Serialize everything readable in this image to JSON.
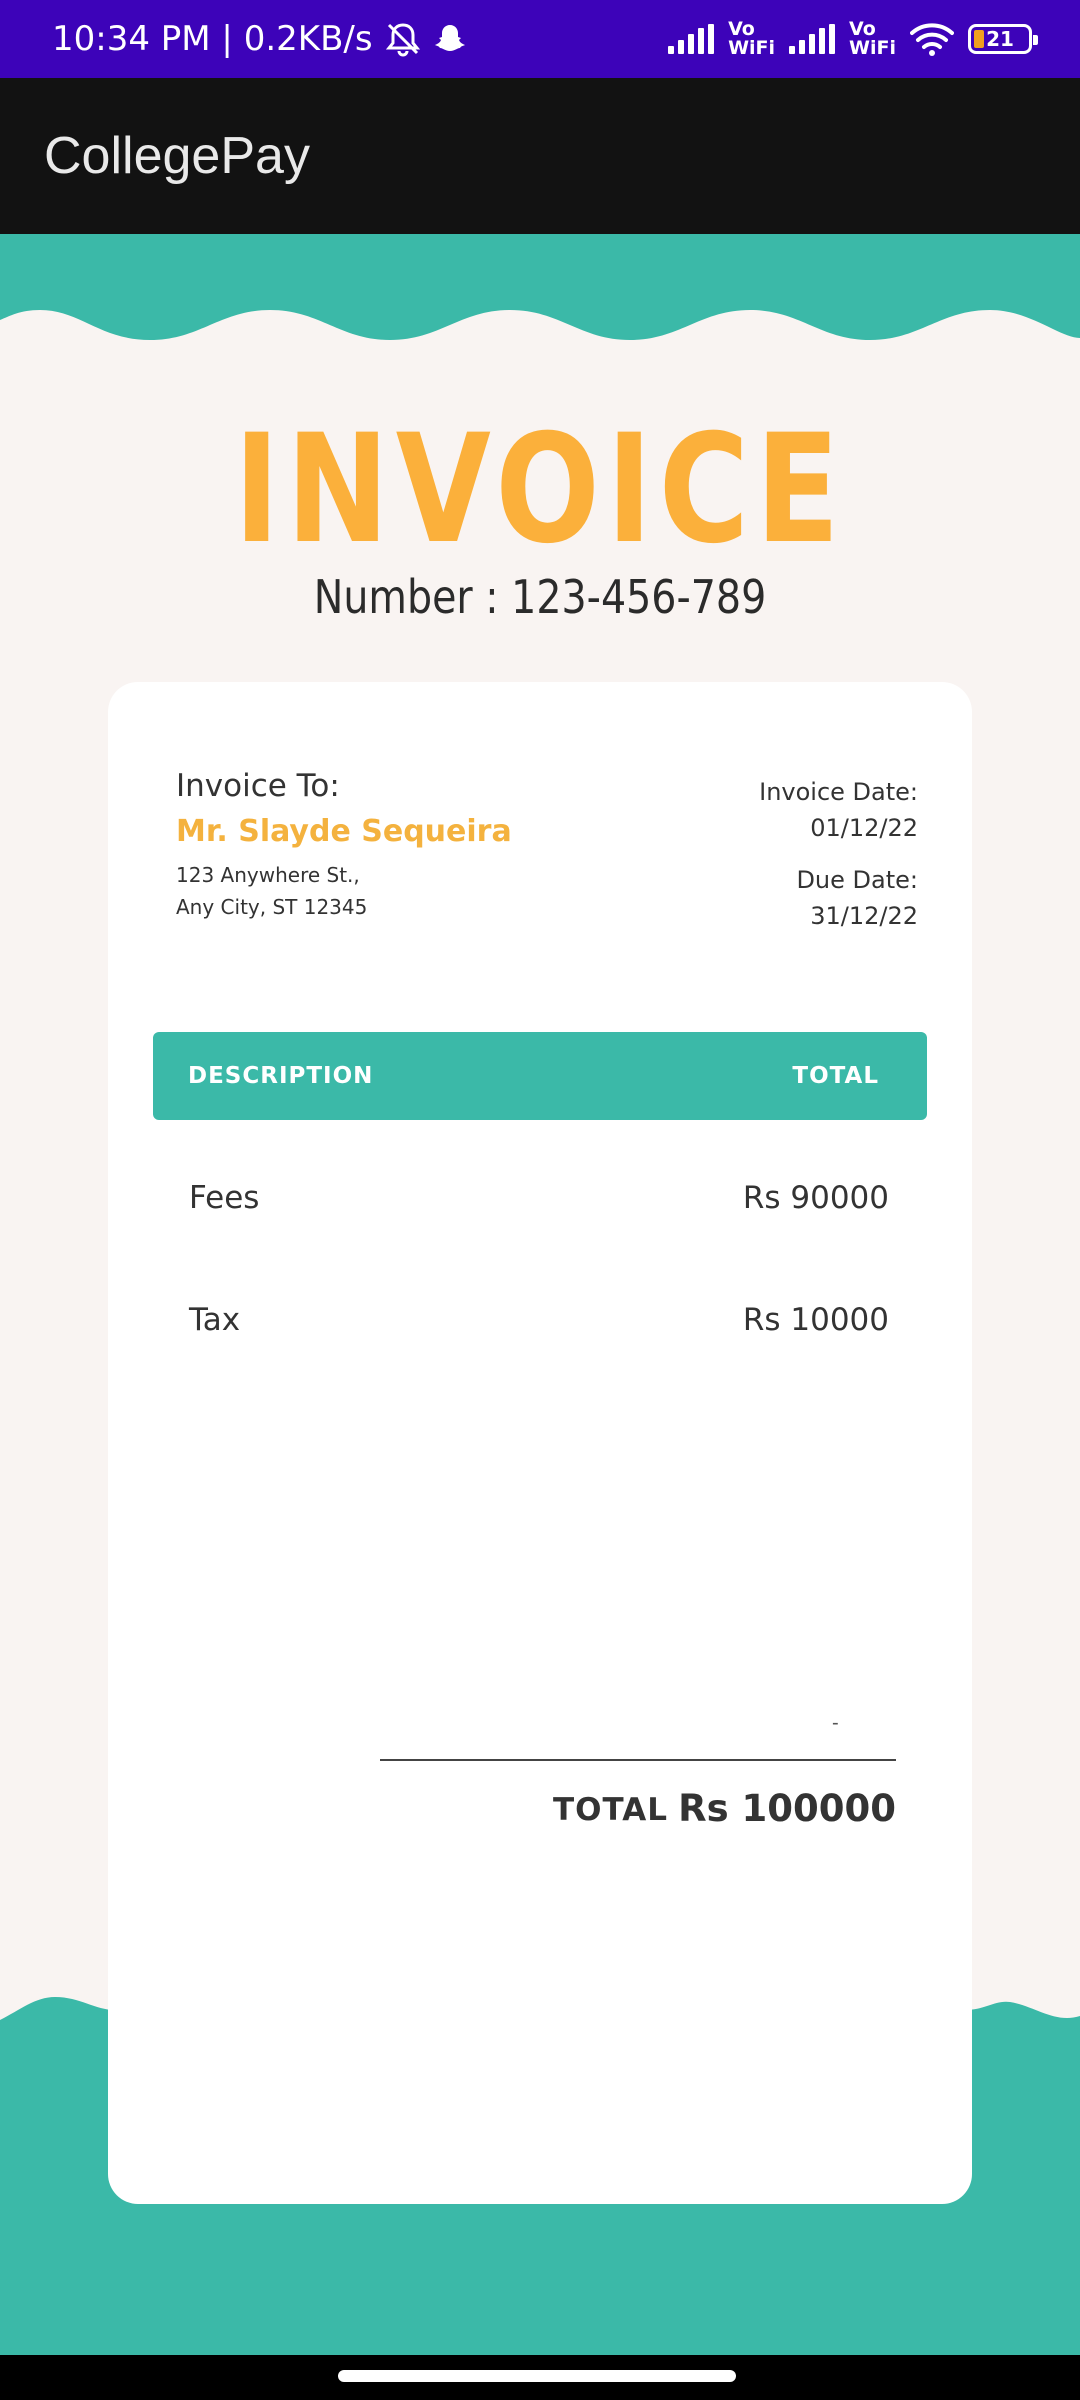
{
  "status_bar": {
    "time_speed": "10:34 PM | 0.2KB/s",
    "vowifi_label_1": "Vo\nWiFi",
    "vowifi_label_2": "Vo\nWiFi",
    "battery_level": "21"
  },
  "app_bar": {
    "title": "CollegePay"
  },
  "invoice": {
    "heading": "INVOICE",
    "number": "Number : 123-456-789",
    "bill_to_label": "Invoice To:",
    "customer_name": "Mr. Slayde Sequeira",
    "address_line1": "123 Anywhere St.,",
    "address_line2": "Any City, ST 12345",
    "invoice_date_label": "Invoice Date:",
    "invoice_date": "01/12/22",
    "due_date_label": "Due Date:",
    "due_date": "31/12/22",
    "table_header": {
      "description": "DESCRIPTION",
      "total": "TOTAL"
    },
    "items": [
      {
        "description": "Fees",
        "amount": "Rs 90000"
      },
      {
        "description": "Tax",
        "amount": "Rs 10000"
      }
    ],
    "dash": "-",
    "total_label": "TOTAL",
    "total_value": "Rs 100000"
  },
  "colors": {
    "status_bar": "#3d03b9",
    "app_bar": "#121212",
    "teal": "#3bb9a8",
    "heading_orange": "#fbb03b",
    "page_bg": "#f9f4f2"
  }
}
